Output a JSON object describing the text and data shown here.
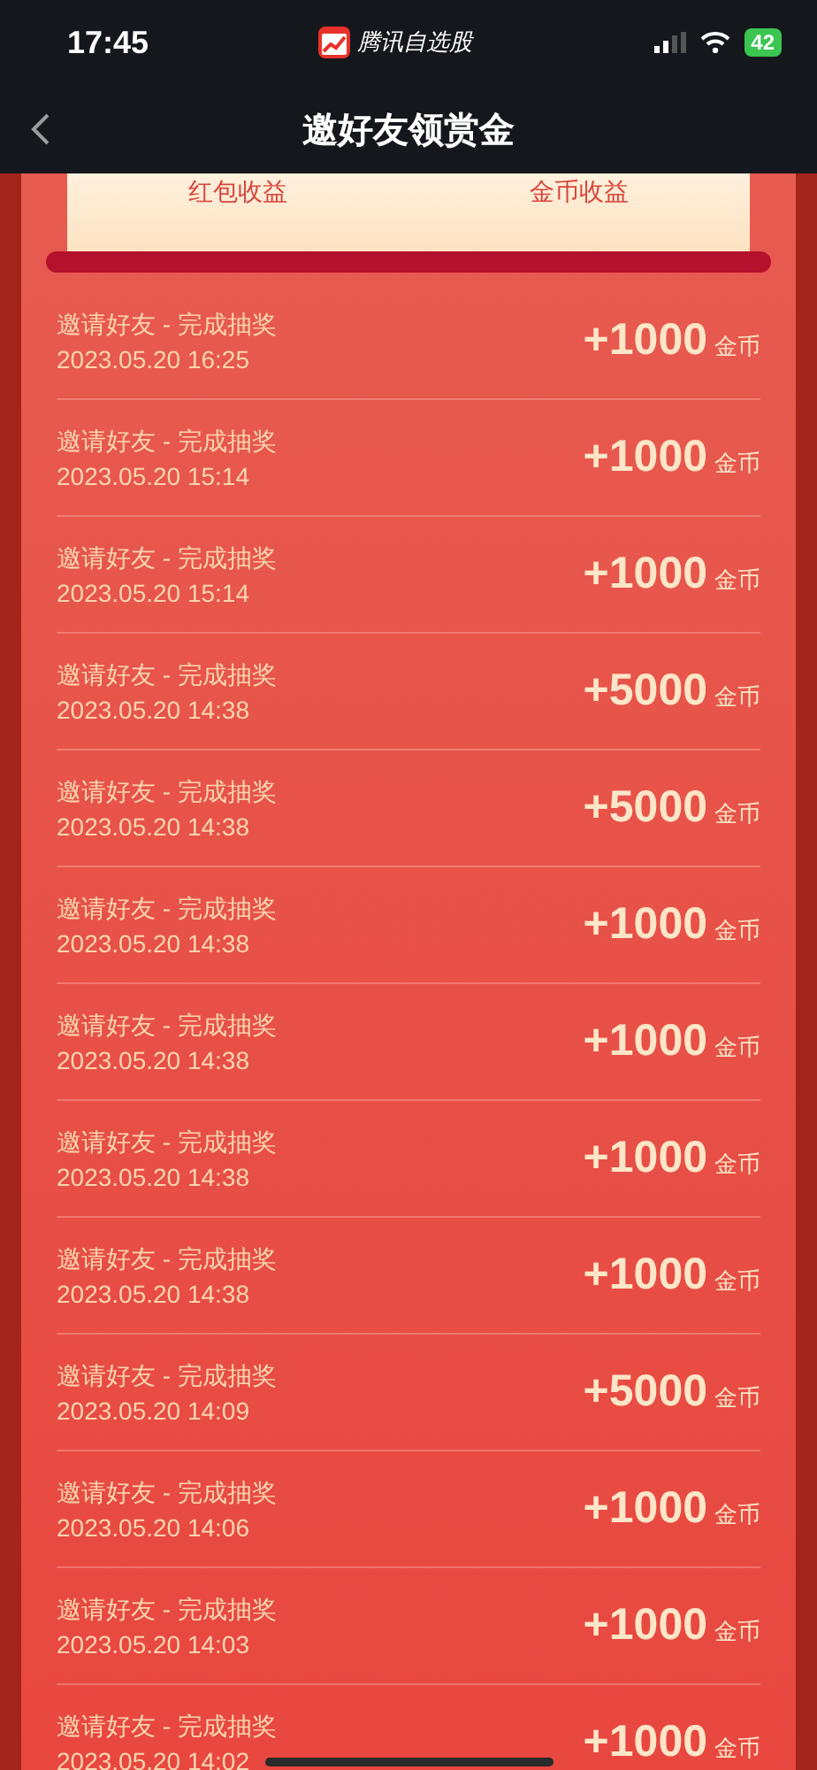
{
  "status_bar": {
    "time": "17:45",
    "app_name": "腾讯自选股",
    "battery": "42"
  },
  "nav": {
    "title": "邀好友领赏金"
  },
  "summary": {
    "labels": [
      "红包收益",
      "金币收益"
    ]
  },
  "records": [
    {
      "title": "邀请好友 - 完成抽奖",
      "date": "2023.05.20 16:25",
      "amount": "+1000",
      "unit": "金币"
    },
    {
      "title": "邀请好友 - 完成抽奖",
      "date": "2023.05.20 15:14",
      "amount": "+1000",
      "unit": "金币"
    },
    {
      "title": "邀请好友 - 完成抽奖",
      "date": "2023.05.20 15:14",
      "amount": "+1000",
      "unit": "金币"
    },
    {
      "title": "邀请好友 - 完成抽奖",
      "date": "2023.05.20 14:38",
      "amount": "+5000",
      "unit": "金币"
    },
    {
      "title": "邀请好友 - 完成抽奖",
      "date": "2023.05.20 14:38",
      "amount": "+5000",
      "unit": "金币"
    },
    {
      "title": "邀请好友 - 完成抽奖",
      "date": "2023.05.20 14:38",
      "amount": "+1000",
      "unit": "金币"
    },
    {
      "title": "邀请好友 - 完成抽奖",
      "date": "2023.05.20 14:38",
      "amount": "+1000",
      "unit": "金币"
    },
    {
      "title": "邀请好友 - 完成抽奖",
      "date": "2023.05.20 14:38",
      "amount": "+1000",
      "unit": "金币"
    },
    {
      "title": "邀请好友 - 完成抽奖",
      "date": "2023.05.20 14:38",
      "amount": "+1000",
      "unit": "金币"
    },
    {
      "title": "邀请好友 - 完成抽奖",
      "date": "2023.05.20 14:09",
      "amount": "+5000",
      "unit": "金币"
    },
    {
      "title": "邀请好友 - 完成抽奖",
      "date": "2023.05.20 14:06",
      "amount": "+1000",
      "unit": "金币"
    },
    {
      "title": "邀请好友 - 完成抽奖",
      "date": "2023.05.20 14:03",
      "amount": "+1000",
      "unit": "金币"
    },
    {
      "title": "邀请好友 - 完成抽奖",
      "date": "2023.05.20 14:02",
      "amount": "+1000",
      "unit": "金币"
    }
  ]
}
